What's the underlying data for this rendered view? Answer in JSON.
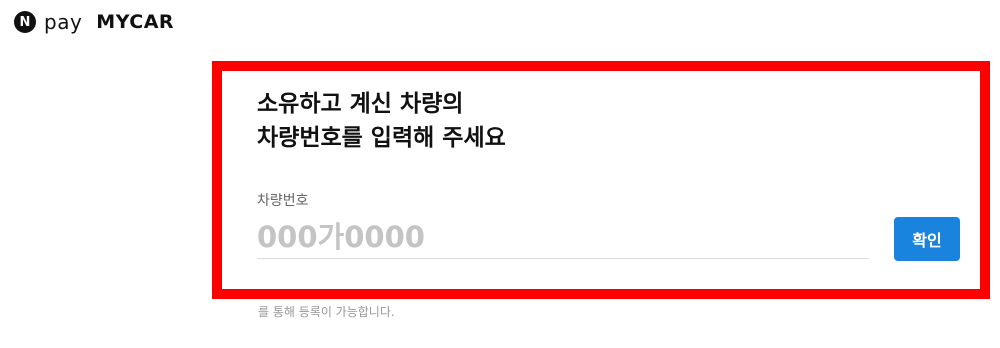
{
  "brand": {
    "badge": "N",
    "pay": "pay",
    "name": "MYCAR"
  },
  "registration": {
    "heading_line1": "소유하고 계신 차량의",
    "heading_line2": "차량번호를 입력해 주세요",
    "field_label": "차량번호",
    "plate_placeholder": "000가0000",
    "plate_value": "",
    "confirm_label": "확인"
  },
  "helper": {
    "line2": "를 통해 등록이 가능합니다."
  },
  "colors": {
    "accent": "#1a83dd",
    "highlight": "#ff0000",
    "text": "#111111",
    "muted": "#999999",
    "placeholder": "#c4c4c4"
  }
}
